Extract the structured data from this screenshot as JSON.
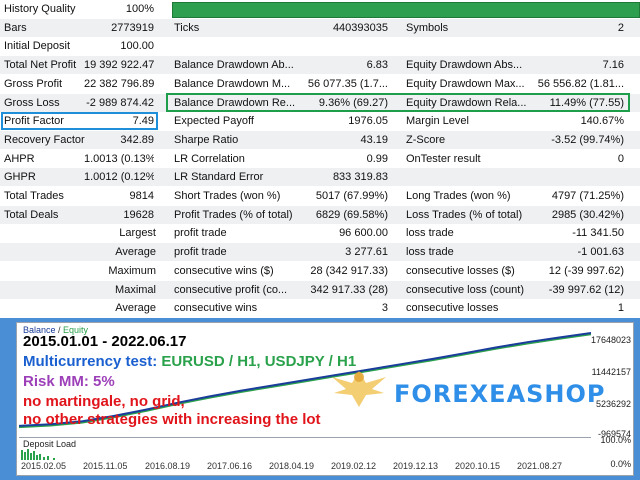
{
  "report": {
    "rows": [
      {
        "c1": "History Quality",
        "v1": "100%",
        "c2": "",
        "v2": "",
        "c3": "",
        "v3": ""
      },
      {
        "c1": "Bars",
        "v1": "2773919",
        "c2": "Ticks",
        "v2": "440393035",
        "c3": "Symbols",
        "v3": "2"
      },
      {
        "c1": "Initial Deposit",
        "v1": "100.00",
        "c2": "",
        "v2": "",
        "c3": "",
        "v3": ""
      },
      {
        "c1": "Total Net Profit",
        "v1": "19 392 922.47",
        "c2": "Balance Drawdown Ab...",
        "v2": "6.83",
        "c3": "Equity Drawdown Abs...",
        "v3": "7.16"
      },
      {
        "c1": "Gross Profit",
        "v1": "22 382 796.89",
        "c2": "Balance Drawdown M...",
        "v2": "56 077.35 (1.7...",
        "c3": "Equity Drawdown Max...",
        "v3": "56 556.82 (1.81..."
      },
      {
        "c1": "Gross Loss",
        "v1": "-2 989 874.42",
        "c2": "Balance Drawdown Re...",
        "v2": "9.36% (69.27)",
        "c3": "Equity Drawdown Rela...",
        "v3": "11.49% (77.55)"
      },
      {
        "c1": "Profit Factor",
        "v1": "7.49",
        "c2": "Expected Payoff",
        "v2": "1976.05",
        "c3": "Margin Level",
        "v3": "140.67%"
      },
      {
        "c1": "Recovery Factor",
        "v1": "342.89",
        "c2": "Sharpe Ratio",
        "v2": "43.19",
        "c3": "Z-Score",
        "v3": "-3.52 (99.74%)"
      },
      {
        "c1": "AHPR",
        "v1": "1.0013 (0.13%)",
        "c2": "LR Correlation",
        "v2": "0.99",
        "c3": "OnTester result",
        "v3": "0"
      },
      {
        "c1": "GHPR",
        "v1": "1.0012 (0.12%)",
        "c2": "LR Standard Error",
        "v2": "833 319.83",
        "c3": "",
        "v3": ""
      },
      {
        "c1": "Total Trades",
        "v1": "9814",
        "c2": "Short Trades (won %)",
        "v2": "5017 (67.99%)",
        "c3": "Long Trades (won %)",
        "v3": "4797 (71.25%)"
      },
      {
        "c1": "Total Deals",
        "v1": "19628",
        "c2": "Profit Trades (% of total)",
        "v2": "6829 (69.58%)",
        "c3": "Loss Trades (% of total)",
        "v3": "2985 (30.42%)"
      },
      {
        "c1": "",
        "v1": "Largest",
        "c2": "profit trade",
        "v2": "96 600.00",
        "c3": "loss trade",
        "v3": "-11 341.50"
      },
      {
        "c1": "",
        "v1": "Average",
        "c2": "profit trade",
        "v2": "3 277.61",
        "c3": "loss trade",
        "v3": "-1 001.63"
      },
      {
        "c1": "",
        "v1": "Maximum",
        "c2": "consecutive wins ($)",
        "v2": "28 (342 917.33)",
        "c3": "consecutive losses ($)",
        "v3": "12 (-39 997.62)"
      },
      {
        "c1": "",
        "v1": "Maximal",
        "c2": "consecutive profit (co...",
        "v2": "342 917.33 (28)",
        "c3": "consecutive loss (count)",
        "v3": "-39 997.62 (12)"
      },
      {
        "c1": "",
        "v1": "Average",
        "c2": "consecutive wins",
        "v2": "3",
        "c3": "consecutive losses",
        "v3": "1"
      }
    ]
  },
  "chart": {
    "legend_balance": "Balance",
    "legend_sep": " / ",
    "legend_equity": "Equity",
    "y_labels": [
      "17648023",
      "11442157",
      "5236292",
      "-969574"
    ],
    "dl_label": "Deposit Load",
    "dl_y_labels": [
      "100.0%",
      "0.0%"
    ],
    "x_labels": [
      "2015.02.05",
      "2015.11.05",
      "2016.08.19",
      "2017.06.16",
      "2018.04.19",
      "2019.02.12",
      "2019.12.13",
      "2020.10.15",
      "2021.08.27"
    ],
    "overlay_dates": "2015.01.01 - 2022.06.17",
    "overlay_multi_prefix": "Multicurrency test: ",
    "overlay_multi_pairs": "EURUSD / H1, USDJPY / H1",
    "overlay_risk": "Risk MM: 5%",
    "overlay_no1": "no martingale, no grid,",
    "overlay_no2": "no other strategies with increasing the lot",
    "brand": "FOREXEASHOP",
    "colors": {
      "balance": "#1a3c9a",
      "equity": "#2aa14b",
      "highlight_blue": "#1e8fd8",
      "highlight_green": "#1e9e4a"
    }
  },
  "chart_data": {
    "type": "line",
    "series": [
      {
        "name": "Balance",
        "values": [
          100,
          300000,
          900000,
          1900000,
          3100000,
          4400000,
          5600000,
          6700000,
          7700000,
          8700000,
          9700000,
          10700000,
          11700000,
          12700000,
          13800000,
          14900000,
          15900000,
          16800000,
          17648023
        ]
      }
    ],
    "ylim": [
      -969574,
      17648023
    ]
  }
}
